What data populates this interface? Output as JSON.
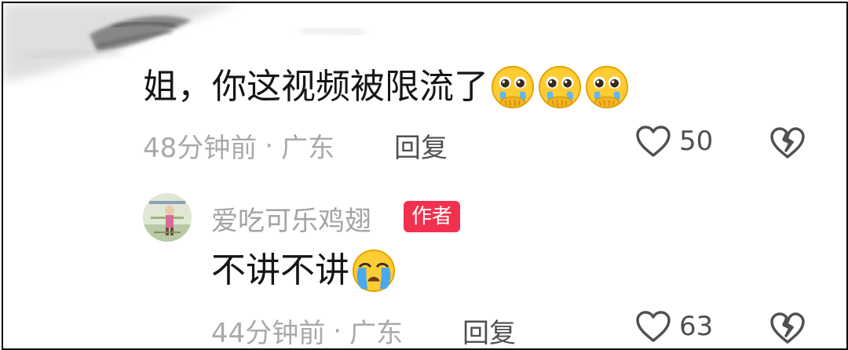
{
  "comments": [
    {
      "text": "姐，你这视频被限流了",
      "emojis": [
        "pleading-face-icon",
        "pleading-face-icon",
        "pleading-face-icon"
      ],
      "time": "48分钟前",
      "separator": "·",
      "location": "广东",
      "reply_label": "回复",
      "likes": "50"
    },
    {
      "username": "爱吃可乐鸡翅",
      "badge": "作者",
      "text": "不讲不讲",
      "emojis": [
        "crying-face-icon"
      ],
      "time": "44分钟前",
      "separator": "·",
      "location": "广东",
      "reply_label": "回复",
      "likes": "63"
    }
  ],
  "colors": {
    "text": "#151515",
    "meta": "#a9a9a9",
    "badge": "#f2314e"
  }
}
